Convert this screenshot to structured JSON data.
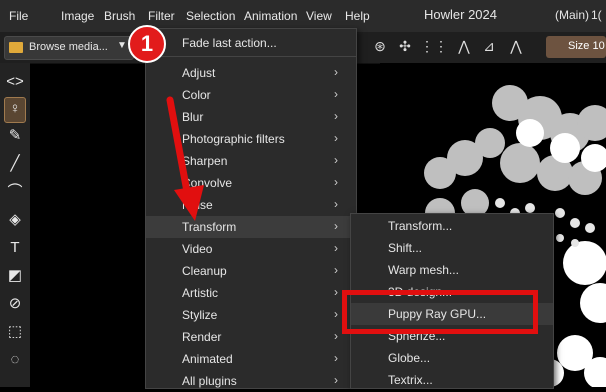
{
  "menubar": {
    "items": [
      "File",
      "Image",
      "Brush",
      "Filter",
      "Selection",
      "Animation",
      "View",
      "Help"
    ],
    "app_title": "Howler 2024",
    "main_label": "(Main)",
    "right_value": "1("
  },
  "toolbar": {
    "browse_label": "Browse media...",
    "size_label": "Size 10"
  },
  "filter_menu": {
    "first_item": "Fade last action...",
    "items": [
      {
        "label": "Adjust"
      },
      {
        "label": "Color"
      },
      {
        "label": "Blur"
      },
      {
        "label": "Photographic filters"
      },
      {
        "label": "Sharpen"
      },
      {
        "label": "Convolve"
      },
      {
        "label": "Noise"
      },
      {
        "label": "Transform"
      },
      {
        "label": "Video"
      },
      {
        "label": "Cleanup"
      },
      {
        "label": "Artistic"
      },
      {
        "label": "Stylize"
      },
      {
        "label": "Render"
      },
      {
        "label": "Animated"
      },
      {
        "label": "All plugins"
      }
    ],
    "highlighted": "Transform"
  },
  "transform_submenu": {
    "items": [
      "Transform...",
      "Shift...",
      "Warp mesh...",
      "3D design...",
      "Puppy Ray GPU...",
      "Spherize...",
      "Globe...",
      "Textrix..."
    ],
    "highlighted": "Puppy Ray GPU..."
  },
  "annotation": {
    "badge_number": "1",
    "color": "#e10f0f"
  },
  "icons": [
    "expand-icon",
    "person-tool-icon",
    "brush-tool-icon",
    "line-tool-icon",
    "curve-tool-icon",
    "fill-tool-icon",
    "text-tool-icon",
    "shape-tool-icon",
    "eraser-tool-icon",
    "rect-select-icon",
    "ellipse-select-icon"
  ]
}
